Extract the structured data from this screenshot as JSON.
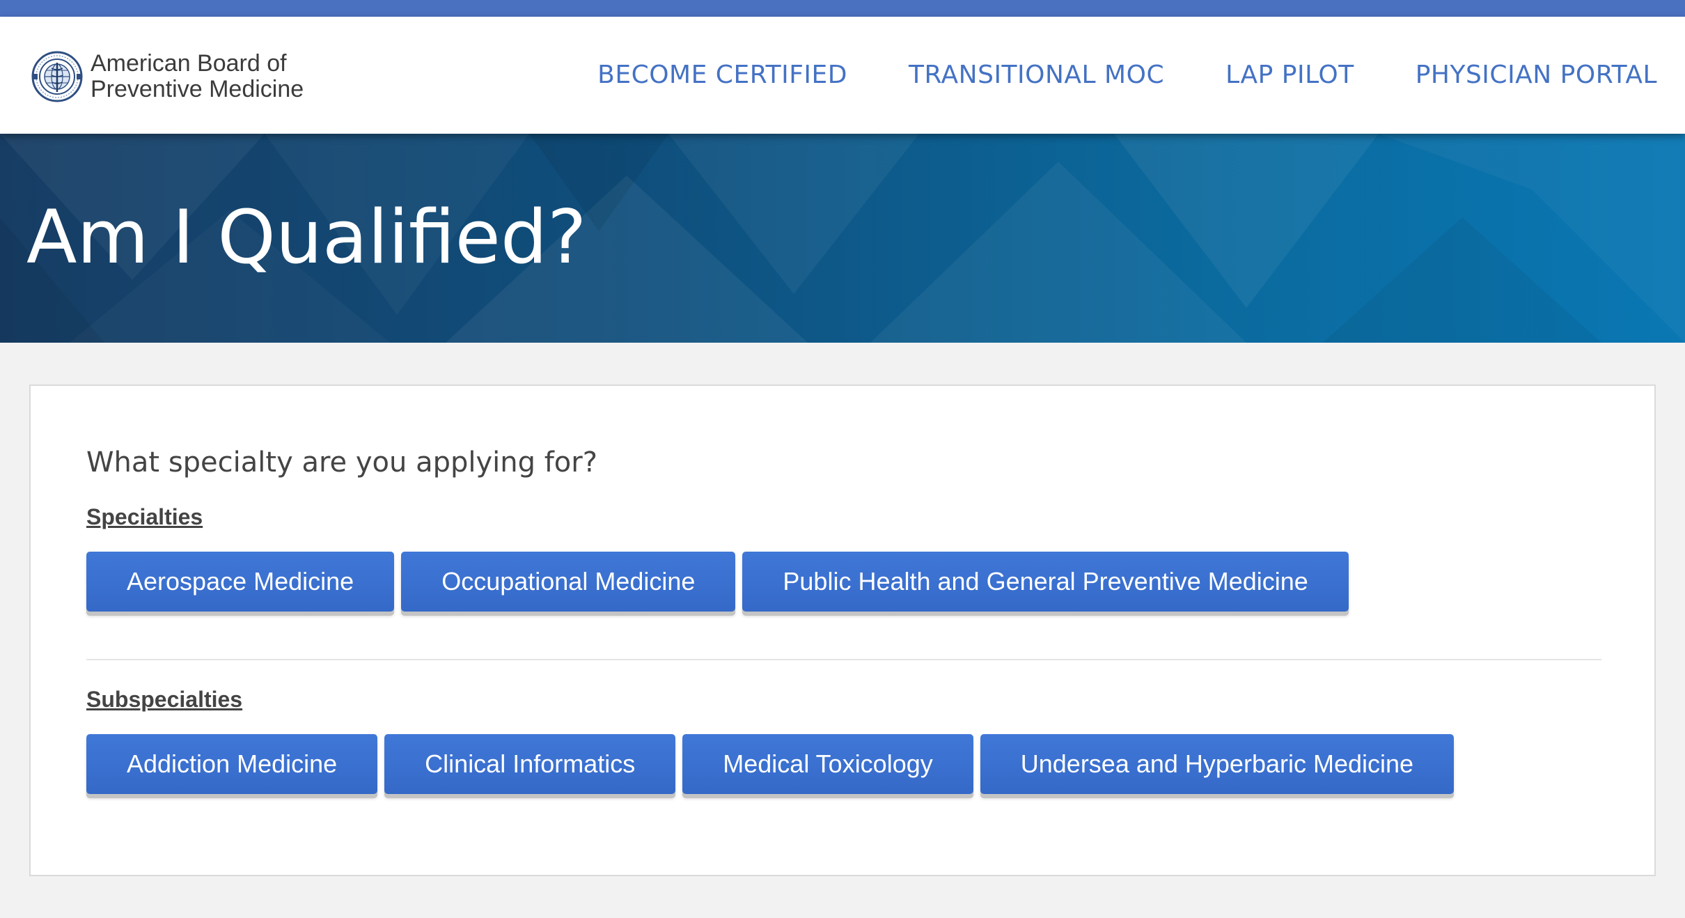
{
  "header": {
    "brand_line1": "American Board of",
    "brand_line2": "Preventive Medicine",
    "seal_icon": "abpm-seal-icon",
    "nav": [
      {
        "label": "BECOME CERTIFIED"
      },
      {
        "label": "TRANSITIONAL MOC"
      },
      {
        "label": "LAP PILOT"
      },
      {
        "label": "PHYSICIAN PORTAL"
      }
    ]
  },
  "hero": {
    "title": "Am I Qualified?"
  },
  "panel": {
    "question": "What specialty are you applying for?",
    "specialties_label": "Specialties",
    "specialties": [
      "Aerospace Medicine",
      "Occupational Medicine",
      "Public Health and General Preventive Medicine"
    ],
    "subspecialties_label": "Subspecialties",
    "subspecialties": [
      "Addiction Medicine",
      "Clinical Informatics",
      "Medical Toxicology",
      "Undersea and Hyperbaric Medicine"
    ]
  },
  "colors": {
    "top_strip": "#4a70c0",
    "nav_text": "#4472c4",
    "button": "#3b70d0",
    "hero_dark": "#173d64",
    "hero_light": "#0a77b3"
  }
}
